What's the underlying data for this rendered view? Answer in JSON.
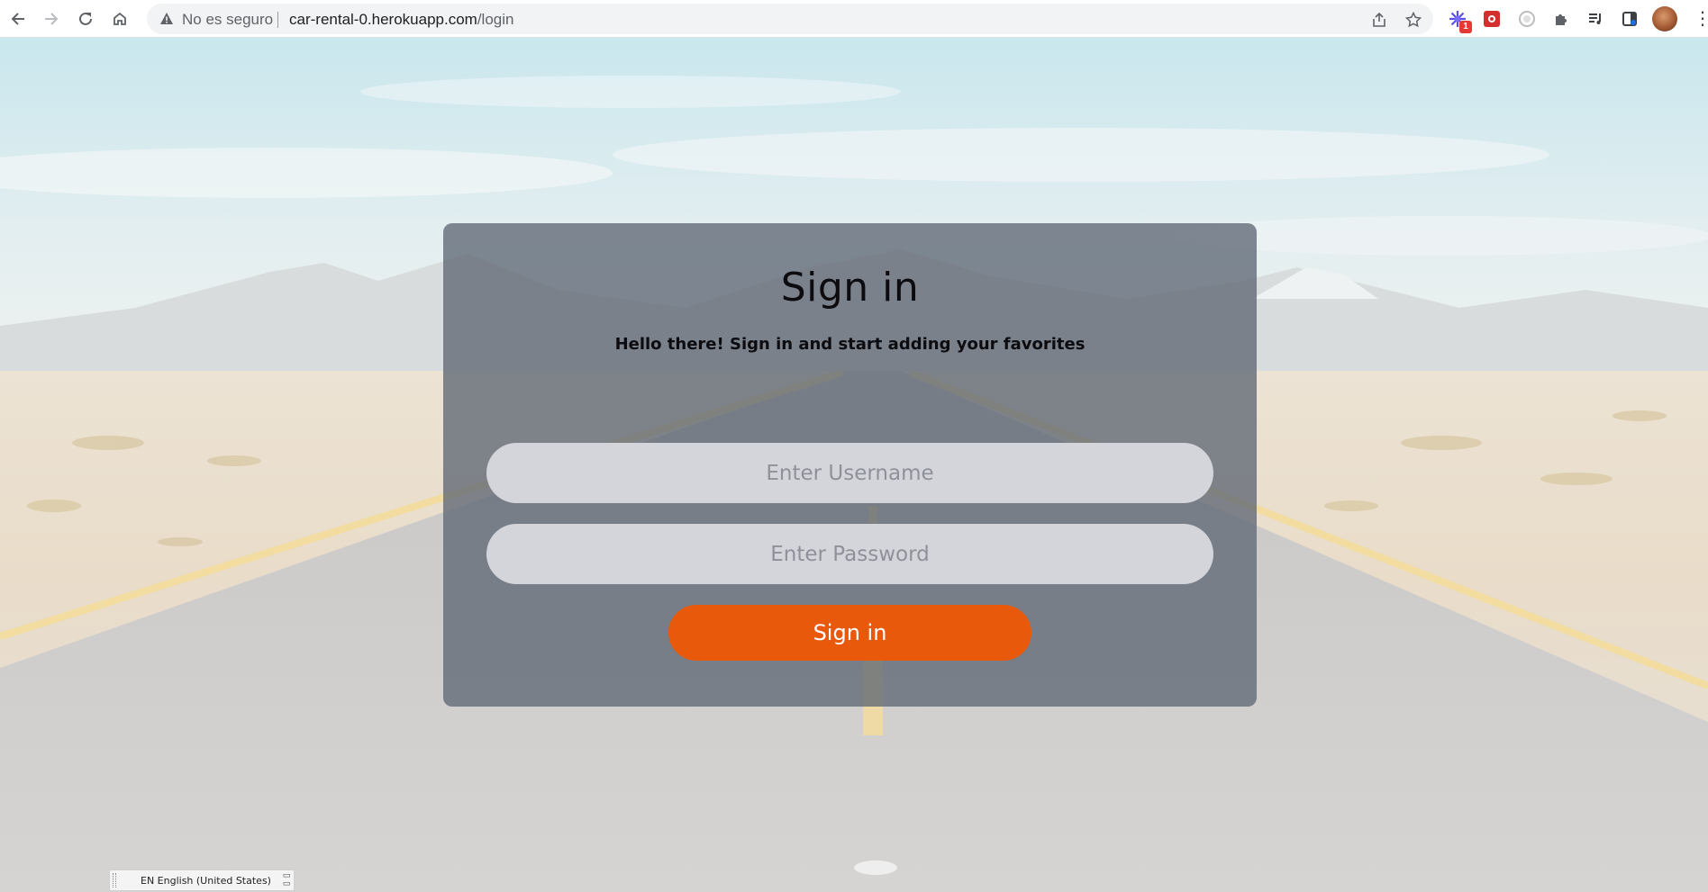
{
  "browser": {
    "security_text": "No es seguro",
    "url_host": "car-rental-0.herokuapp.com",
    "url_path": "/login",
    "extension_badge": "1"
  },
  "login": {
    "title": "Sign in",
    "subtitle": "Hello there! Sign in and start adding your favorites",
    "username_placeholder": "Enter Username",
    "password_placeholder": "Enter Password",
    "submit_label": "Sign in",
    "accent_color": "#e8590c"
  },
  "language_bar": {
    "text": "EN English (United States)"
  },
  "icons": [
    "back-arrow-icon",
    "forward-arrow-icon",
    "reload-icon",
    "home-icon",
    "warning-icon",
    "share-icon",
    "star-icon",
    "puzzle-icon",
    "media-icon",
    "sidebar-icon",
    "more-icon"
  ]
}
